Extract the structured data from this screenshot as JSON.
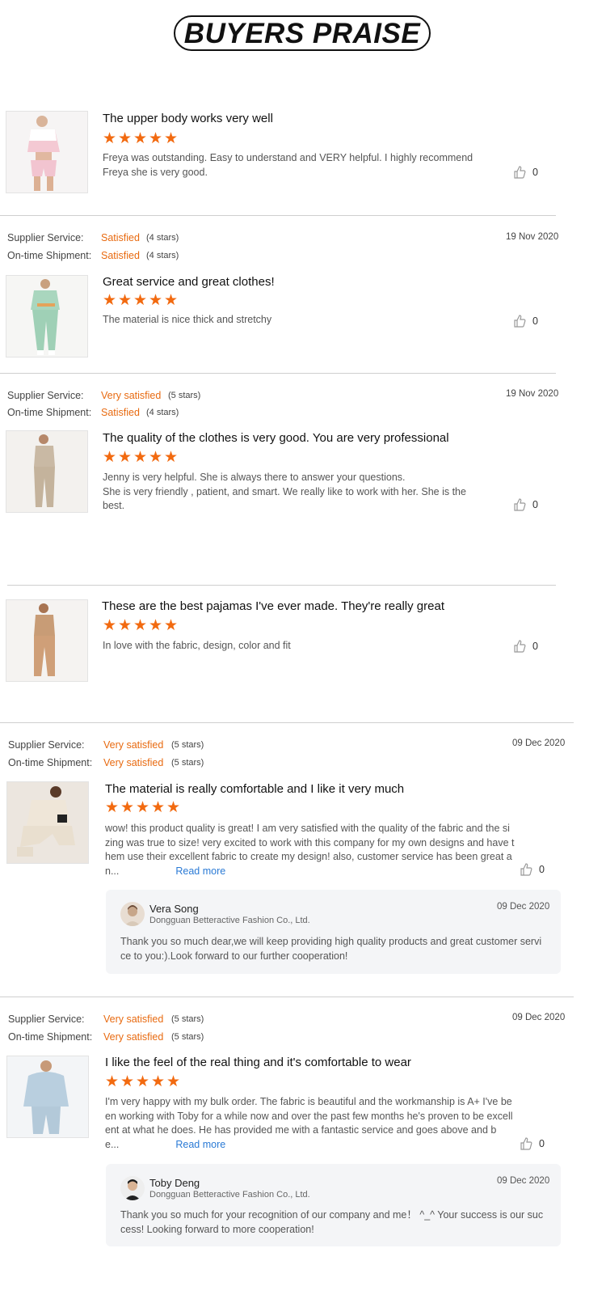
{
  "header": {
    "title": "BUYERS PRAISE"
  },
  "colors": {
    "accent": "#f26a10",
    "link": "#2a7ad5",
    "reply_bg": "#f4f5f7"
  },
  "labels": {
    "supplier_service": "Supplier Service:",
    "on_time_shipment": "On-time Shipment:",
    "read_more": "Read more"
  },
  "reviews": [
    {
      "title": "The upper body works very well",
      "stars": 5,
      "body": "Freya was outstanding. Easy to understand and VERY helpful. I highly recommend Freya she is very good.",
      "likes": "0",
      "thumb": "pink-white-cropped-outfit"
    },
    {
      "supplier_value": "Satisfied",
      "supplier_stars": "(4 stars)",
      "shipment_value": "Satisfied",
      "shipment_stars": "(4 stars)",
      "date": "19 Nov 2020",
      "title": "Great service and great clothes!",
      "stars": 5,
      "body": "The material is nice thick and stretchy",
      "likes": "0",
      "thumb": "mint-green-tracksuit"
    },
    {
      "supplier_value": "Very satisfied",
      "supplier_stars": "(5 stars)",
      "shipment_value": "Satisfied",
      "shipment_stars": "(4 stars)",
      "date": "19 Nov 2020",
      "title": "The quality of the clothes is very good. You are very professional",
      "stars": 5,
      "body": "Jenny is very helpful. She is always there to answer your questions.\nShe is  very friendly , patient, and smart. We really like to work with her. She is the best.",
      "likes": "0",
      "thumb": "beige-set"
    },
    {
      "title": "These are the best pajamas I've ever made. They're really great",
      "stars": 5,
      "body": "In love with the fabric, design,  color and fit",
      "likes": "0",
      "thumb": "tan-jumpsuit"
    },
    {
      "supplier_value": "Very satisfied",
      "supplier_stars": "(5 stars)",
      "shipment_value": "Very satisfied",
      "shipment_stars": "(5 stars)",
      "date": "09 Dec 2020",
      "title": "The material is really comfortable and I like it very much",
      "stars": 5,
      "body": "wow! this product quality is great! I am very satisfied with the quality of the fabric and the si zing was true to size! very excited to work with this company for my own designs and have t hem use their excellent fabric to create my design! also, customer service has been great a n...",
      "likes": "0",
      "thumb": "cream-lounge-set",
      "reply": {
        "name": "Vera Song",
        "company": "Dongguan Betteractive Fashion Co., Ltd.",
        "date": "09 Dec 2020",
        "text": "Thank you so much dear,we will keep providing high quality products and great customer servi ce to you:).Look forward to our further cooperation!"
      }
    },
    {
      "supplier_value": "Very satisfied",
      "supplier_stars": "(5 stars)",
      "shipment_value": "Very satisfied",
      "shipment_stars": "(5 stars)",
      "date": "09 Dec 2020",
      "title": "I like the feel of the real thing and it's comfortable to wear",
      "stars": 5,
      "body": "I'm very happy with my bulk order. The fabric is beautiful and the workmanship is A+ I've be en working with Toby for a while now and over the past few months he's proven to be excell ent at what he does. He has provided me with a fantastic service and goes above and b e...",
      "likes": "0",
      "thumb": "light-blue-hoodie-set",
      "reply": {
        "name": "Toby Deng",
        "company": "Dongguan Betteractive Fashion Co., Ltd.",
        "date": "09 Dec 2020",
        "text": "Thank you so much for your recognition of our company and me！ ^_^ Your success is our suc cess! Looking forward to more cooperation!"
      }
    }
  ]
}
